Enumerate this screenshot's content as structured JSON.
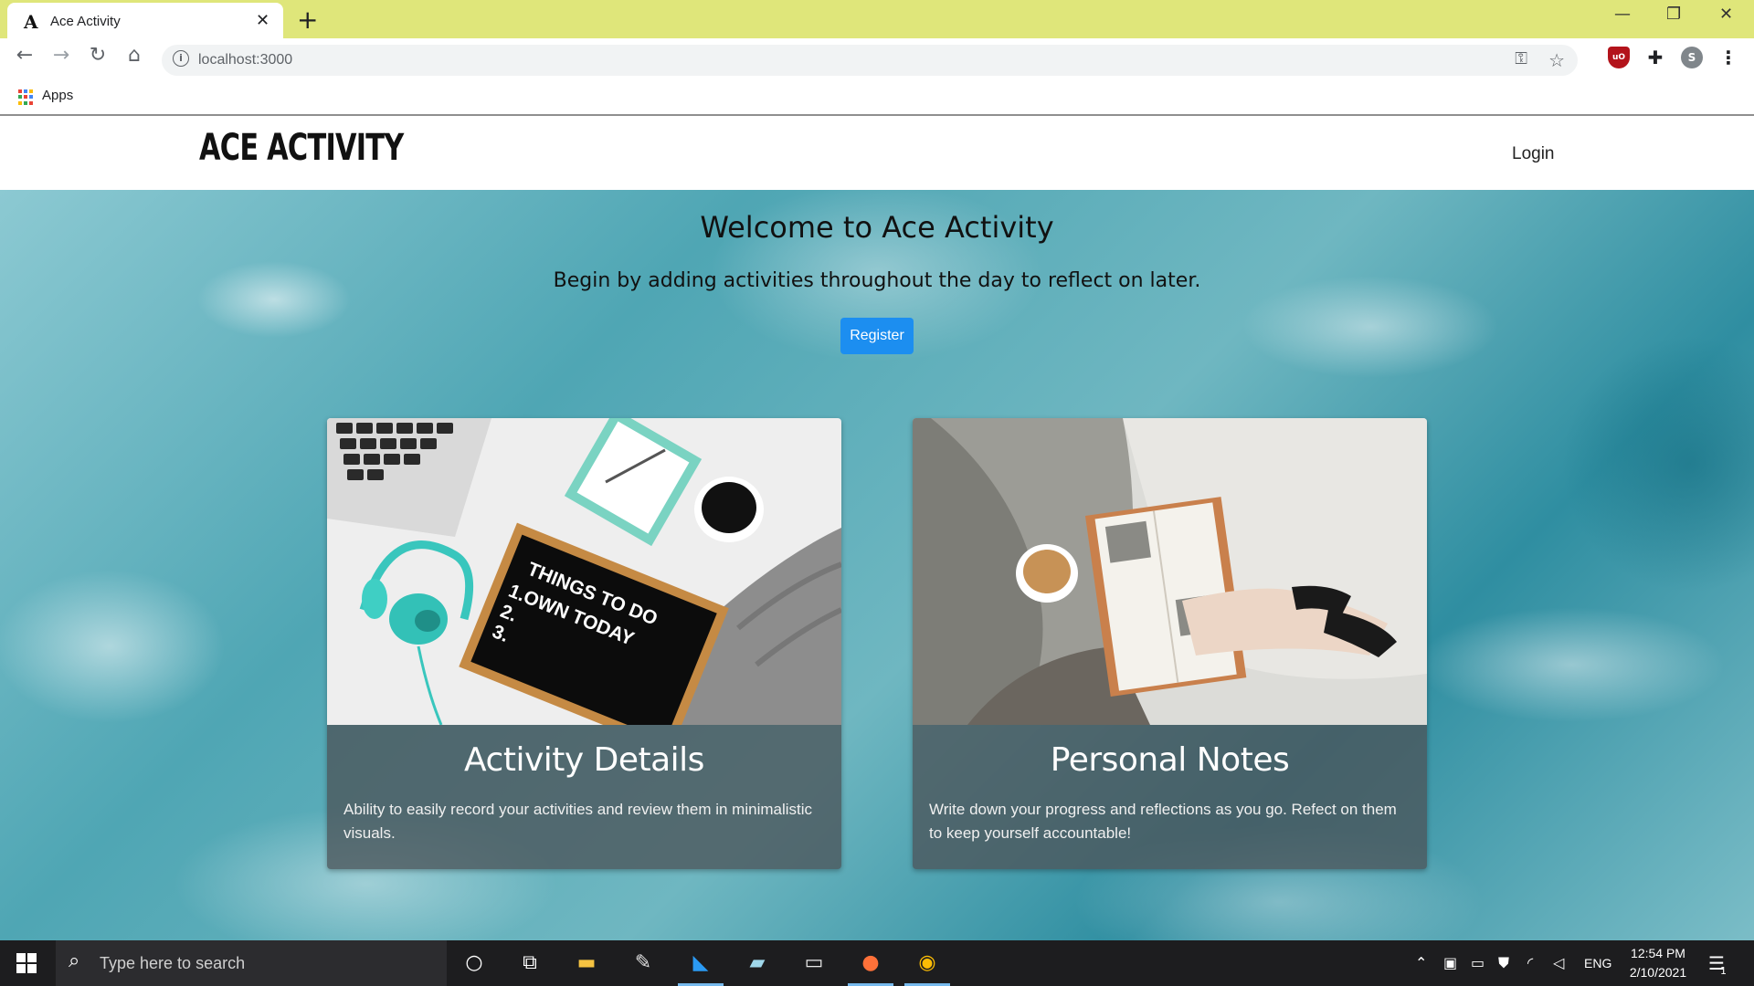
{
  "browser": {
    "tab_title": "Ace Activity",
    "tab_favicon": "A",
    "url": "localhost:3000",
    "bookmark_apps": "Apps",
    "profile_initial": "S"
  },
  "site": {
    "brand": "ACE ACTIVITY",
    "login": "Login"
  },
  "hero": {
    "title": "Welcome to Ace Activity",
    "subtitle": "Begin by adding activities throughout the day to reflect on later.",
    "register": "Register"
  },
  "cards": [
    {
      "title": "Activity Details",
      "text": "Ability to easily record your activities and review them in minimalistic visuals.",
      "board_text": "THINGS TO DO 1.OWN TODAY 2. 3."
    },
    {
      "title": "Personal Notes",
      "text": "Write down your progress and reflections as you go. Refect on them to keep yourself accountable!"
    }
  ],
  "taskbar": {
    "search_placeholder": "Type here to search",
    "lang": "ENG",
    "time": "12:54 PM",
    "date": "2/10/2021",
    "notification_count": "1"
  },
  "colors": {
    "tabbar_bg": "#dfe67a",
    "register_btn": "#1c8ef0",
    "taskbar_bg": "#1d1d1f"
  }
}
